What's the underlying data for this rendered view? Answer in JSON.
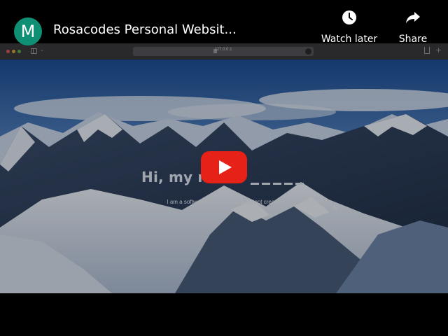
{
  "player": {
    "channel_avatar_letter": "M",
    "title": "Rosacodes Personal Websit...",
    "actions": {
      "watch_later": {
        "label": "Watch later",
        "icon": "clock-icon"
      },
      "share": {
        "label": "Share",
        "icon": "share-arrow-icon"
      }
    },
    "play_button": {
      "icon": "play-icon",
      "color": "#e62117"
    }
  },
  "browser": {
    "url": "127.0.0.1"
  },
  "page": {
    "hero_title": "Hi, my n",
    "hero_subtitle": "I am a software developer and content creator"
  },
  "colors": {
    "avatar": "#0f8f74",
    "player_background": "#000000"
  }
}
